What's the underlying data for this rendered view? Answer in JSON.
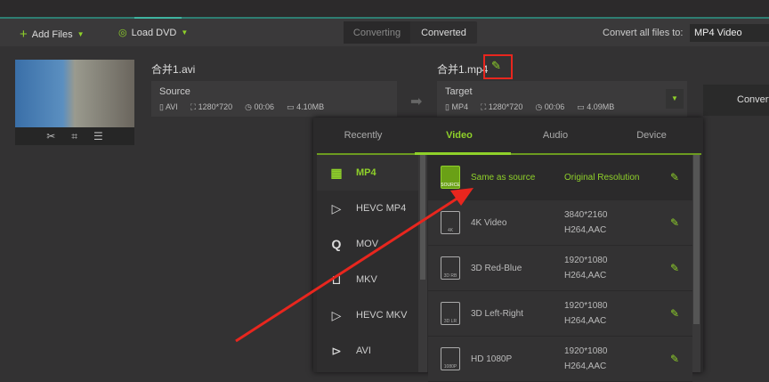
{
  "toolbar": {
    "add_files": "Add Files",
    "load_dvd": "Load DVD",
    "tab_converting": "Converting",
    "tab_converted": "Converted",
    "convert_all_label": "Convert all files to:",
    "convert_all_value": "MP4 Video"
  },
  "source": {
    "filename": "合并1.avi",
    "label": "Source",
    "format": "AVI",
    "resolution": "1280*720",
    "duration": "00:06",
    "size": "4.10MB"
  },
  "target": {
    "filename": "合并1.mp4",
    "label": "Target",
    "format": "MP4",
    "resolution": "1280*720",
    "duration": "00:06",
    "size": "4.09MB"
  },
  "convert_button": "Convert",
  "dropdown": {
    "tabs": [
      "Recently",
      "Video",
      "Audio",
      "Device"
    ],
    "active_tab": "Video",
    "formats": [
      {
        "label": "MP4",
        "icon": "film-icon"
      },
      {
        "label": "HEVC MP4",
        "icon": "hevc-icon"
      },
      {
        "label": "MOV",
        "icon": "quicktime-icon"
      },
      {
        "label": "MKV",
        "icon": "mkv-icon"
      },
      {
        "label": "HEVC MKV",
        "icon": "hevc-icon"
      },
      {
        "label": "AVI",
        "icon": "play-circle-icon"
      }
    ],
    "presets": [
      {
        "name": "Same as source",
        "res": "Original Resolution",
        "codec": "",
        "badge": "SOURCE"
      },
      {
        "name": "4K Video",
        "res": "3840*2160",
        "codec": "H264,AAC",
        "badge": "4K"
      },
      {
        "name": "3D Red-Blue",
        "res": "1920*1080",
        "codec": "H264,AAC",
        "badge": "3D RB"
      },
      {
        "name": "3D Left-Right",
        "res": "1920*1080",
        "codec": "H264,AAC",
        "badge": "3D LR"
      },
      {
        "name": "HD 1080P",
        "res": "1920*1080",
        "codec": "H264,AAC",
        "badge": "1080P"
      }
    ]
  },
  "colors": {
    "accent": "#8fd12a",
    "annotation": "#e8261e",
    "teal": "#2e7d72"
  }
}
